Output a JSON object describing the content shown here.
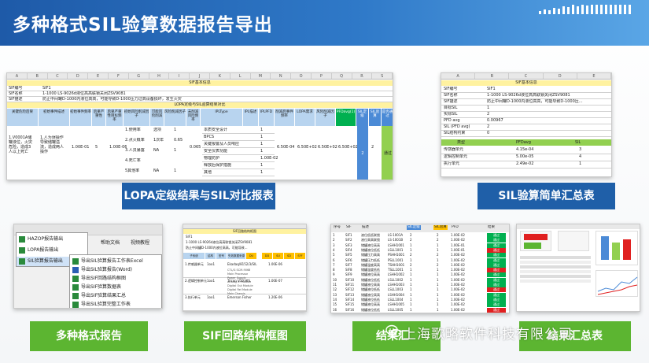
{
  "header": {
    "title": "多种格式SIL验算数据报告导出"
  },
  "sheet1": {
    "columns": [
      "A",
      "B",
      "C",
      "D",
      "E",
      "F",
      "G",
      "H",
      "I",
      "J",
      "K",
      "L",
      "M",
      "N",
      "O",
      "P",
      "Q",
      "R",
      "S"
    ],
    "section_basic": "SIF基本信息",
    "rows_basic": [
      {
        "k": "SIF编号",
        "v": "SIF1"
      },
      {
        "k": "SIF名称",
        "v": "1-1000 LS-9026d液位高高联锁关闭ZSV9081"
      },
      {
        "k": "SIF描述",
        "v": "防止中间罐D-1000内液位高高，可能导致D-1000压力过高设备损坏，发生火灾"
      }
    ],
    "section_lopa": "LOPA定级与SIL验算结果对比",
    "headers": [
      "关键危险后果",
      "初始事件描述",
      "初始事件频率",
      "后果严重性",
      "后果严重性目标频率",
      "初始风险削减因子",
      "可能风险削减",
      "风险削减因子",
      "未削减风险频率",
      "IPLType",
      "IPL描述",
      "IPLPFD",
      "削减后事件频率",
      "LOPA需求",
      "风险削减因子",
      "PFDavg(1)",
      "SIL定级",
      "SIL验算",
      "是否通过"
    ],
    "consequence": "1.V0001A储罐液位，火灾危险，造成3人以上死亡",
    "initiating": "1.人为误操作导致储罐溢流，造成两人操作",
    "freq": "1.00E-01",
    "severity": "5",
    "target": "1.00E-06",
    "factors": [
      {
        "name": "1.使用率",
        "opt": "选项",
        "val": "1"
      },
      {
        "name": "2.点火概率",
        "opt": "1次年",
        "val": "0.65"
      },
      {
        "name": "3.人员暴露",
        "opt": "NA",
        "val": "1"
      },
      {
        "name": "4.死亡率",
        "opt": "",
        "val": ""
      },
      {
        "name": "5其他率",
        "opt": "NA",
        "val": "1"
      }
    ],
    "unmitigated": "0.065",
    "ipl_types": [
      "本质安全设计",
      "BPCS",
      "关键报警及人员响应",
      "安全仪表功能",
      "物理防护",
      "释放后保护措施",
      "其他"
    ],
    "ipl_pfd": [
      "1",
      "1",
      "1",
      "1",
      "1.00E-02",
      "1",
      "1"
    ],
    "mitigated": "6.50E-04",
    "lopa_req": "6.50E+02",
    "rrf": "6.50E+02",
    "pfd": "6.50E+02",
    "sil_level": "2",
    "sil_calc": "2",
    "pass": "通过",
    "pfd_header_color": "#00b050"
  },
  "sheet2": {
    "columns": [
      "A",
      "B",
      "C",
      "D",
      "E"
    ],
    "section": "SIF基本信息",
    "rows": [
      {
        "k": "SIF编号",
        "v": "SIF1"
      },
      {
        "k": "SIF名称",
        "v": "1-1000 LS-9026d液位高高联锁关闭ZSV9081"
      },
      {
        "k": "SIF描述",
        "v": "防止中间罐D-1000内液位高高，可能导致D-1000压..."
      },
      {
        "k": "目标SIL",
        "v": "1"
      },
      {
        "k": "实际SIL",
        "v": "2"
      },
      {
        "k": "PFD avg",
        "v": "0.00967"
      },
      {
        "k": "SIL (PFD avg)",
        "v": "2"
      },
      {
        "k": "SIL结构约束",
        "v": "0"
      }
    ],
    "table_head": [
      "类型",
      "PFDavg",
      "SIL"
    ],
    "table_rows": [
      {
        "t": "传感器单元",
        "p": "4.15e-04",
        "s": "3"
      },
      {
        "t": "逻辑控制单元",
        "p": "5.00e-05",
        "s": "4"
      },
      {
        "t": "执行单元",
        "p": "2.49e-02",
        "s": "1"
      }
    ]
  },
  "labels": {
    "lopa": "LOPA定级结果与SIL对比报表",
    "sil_summary": "SIL验算简单汇总表",
    "formats": "多种格式报告",
    "loop": "SIF回路结构框图",
    "result": "结果汇",
    "right": "结果汇总表"
  },
  "menu": {
    "items": [
      "HAZOP报告输出",
      "LOPA报告输出",
      "SIL验算报告输出"
    ],
    "toolbar": [
      "帮助文档",
      "视频教程"
    ],
    "submenu": [
      "导出SIL验算报告工作表Excel",
      "导出SIL验算报告(Word)",
      "导出SIF回路结构框图",
      "导出SIF验算数据表",
      "导出SIF验算结果汇总",
      "导出SIL验算完整工作表"
    ]
  },
  "loop_sheet": {
    "header": "SIF回路结构框图",
    "title_rows": [
      "SIF1",
      "1-1000 LS-9026d液位高高联锁关闭ZSV9081",
      "防止中间罐D-1000内液位高高，可能导致..."
    ],
    "col_heads": [
      "子系统",
      "结构",
      "型号",
      "失效数据来源",
      "DU",
      "DD",
      "SU",
      "SD",
      "SFF"
    ],
    "rows": [
      {
        "a": "1.传感器单元",
        "b": "1oo1",
        "c": "Ekadaq/8152/3/SIL",
        "d": "1.00E-06"
      },
      {
        "a": "2.逻辑控制单元",
        "b": "1oo1",
        "c": "Tricon V10 HIS",
        "d": "1.00E-07"
      },
      {
        "a": "3.执行单元",
        "b": "1oo1",
        "c": "Emerson Fisher",
        "d": "1.20E-06"
      }
    ],
    "sub_items": [
      "CTL/G SCM-9068",
      "Main Processor",
      "Power Supply",
      "Analog In Module",
      "Digital Out Module",
      "Digital Rel Module",
      "Main Chassis"
    ]
  },
  "result_sheet": {
    "col_heads": [
      "序号",
      "SIF",
      "描述",
      "SIL定级",
      "SIL验算",
      "PFD",
      "结果"
    ],
    "rows": [
      {
        "n": "1",
        "s": "SIF1",
        "d": "液位低低联锁",
        "tag": "LS-1001A",
        "l": "2",
        "c": "2",
        "p": "1.00E-02",
        "r": "通过"
      },
      {
        "n": "2",
        "s": "SIF2",
        "d": "液位高高联锁",
        "tag": "LS-1001B",
        "l": "2",
        "c": "2",
        "p": "1.00E-02",
        "r": "通过"
      },
      {
        "n": "3",
        "s": "SIF3",
        "d": "储罐液位高高",
        "tag": "LSHH1001",
        "l": "1",
        "c": "1",
        "p": "1.00E-01",
        "r": "通过"
      },
      {
        "n": "4",
        "s": "SIF4",
        "d": "储罐液位低低",
        "tag": "LSLL1001",
        "l": "1",
        "c": "1",
        "p": "1.00E-01",
        "r": "通过"
      },
      {
        "n": "5",
        "s": "SIF5",
        "d": "储罐压力高高",
        "tag": "PSHH1001",
        "l": "2",
        "c": "2",
        "p": "1.00E-02",
        "r": "通过"
      },
      {
        "n": "6",
        "s": "SIF6",
        "d": "储罐压力低低",
        "tag": "PSLL1001",
        "l": "1",
        "c": "1",
        "p": "1.00E-02",
        "r": "通过"
      },
      {
        "n": "7",
        "s": "SIF7",
        "d": "储罐温度高高",
        "tag": "TSHH1001",
        "l": "2",
        "c": "2",
        "p": "1.00E-02",
        "r": "通过"
      },
      {
        "n": "8",
        "s": "SIF8",
        "d": "储罐温度低低",
        "tag": "TSLL1001",
        "l": "1",
        "c": "1",
        "p": "1.00E-02",
        "r": "通过"
      },
      {
        "n": "9",
        "s": "SIF9",
        "d": "储罐液位高高",
        "tag": "LSHH1002",
        "l": "1",
        "c": "1",
        "p": "1.00E-02",
        "r": "通过"
      },
      {
        "n": "10",
        "s": "SIF10",
        "d": "储罐液位低低",
        "tag": "LSLL1002",
        "l": "1",
        "c": "1",
        "p": "1.00E-02",
        "r": "通过"
      },
      {
        "n": "11",
        "s": "SIF11",
        "d": "储罐液位高高",
        "tag": "LSHH1003",
        "l": "1",
        "c": "1",
        "p": "1.00E-02",
        "r": "通过"
      },
      {
        "n": "12",
        "s": "SIF12",
        "d": "储罐液位低低",
        "tag": "LSLL1003",
        "l": "1",
        "c": "1",
        "p": "1.00E-02",
        "r": "通过"
      },
      {
        "n": "13",
        "s": "SIF13",
        "d": "储罐液位高高",
        "tag": "LSHH1004",
        "l": "1",
        "c": "1",
        "p": "1.00E-02",
        "r": "通过"
      },
      {
        "n": "14",
        "s": "SIF14",
        "d": "储罐液位低低",
        "tag": "LSLL1004",
        "l": "1",
        "c": "1",
        "p": "1.00E-02",
        "r": "通过"
      },
      {
        "n": "15",
        "s": "SIF15",
        "d": "储罐液位高高",
        "tag": "LSHH1005",
        "l": "1",
        "c": "1",
        "p": "1.00E-02",
        "r": "通过"
      },
      {
        "n": "16",
        "s": "SIF16",
        "d": "储罐液位低低",
        "tag": "LSLL1005",
        "l": "1",
        "c": "1",
        "p": "1.00E-02",
        "r": "通过"
      }
    ]
  },
  "watermark": {
    "text": "上海歌略软件科技有限公司"
  },
  "colors": {
    "header_dark": "#1e5aa8",
    "label_blue": "#1f5fa8",
    "label_green": "#5cb531",
    "pass_green": "#00b050",
    "fail_red": "#e02020"
  }
}
